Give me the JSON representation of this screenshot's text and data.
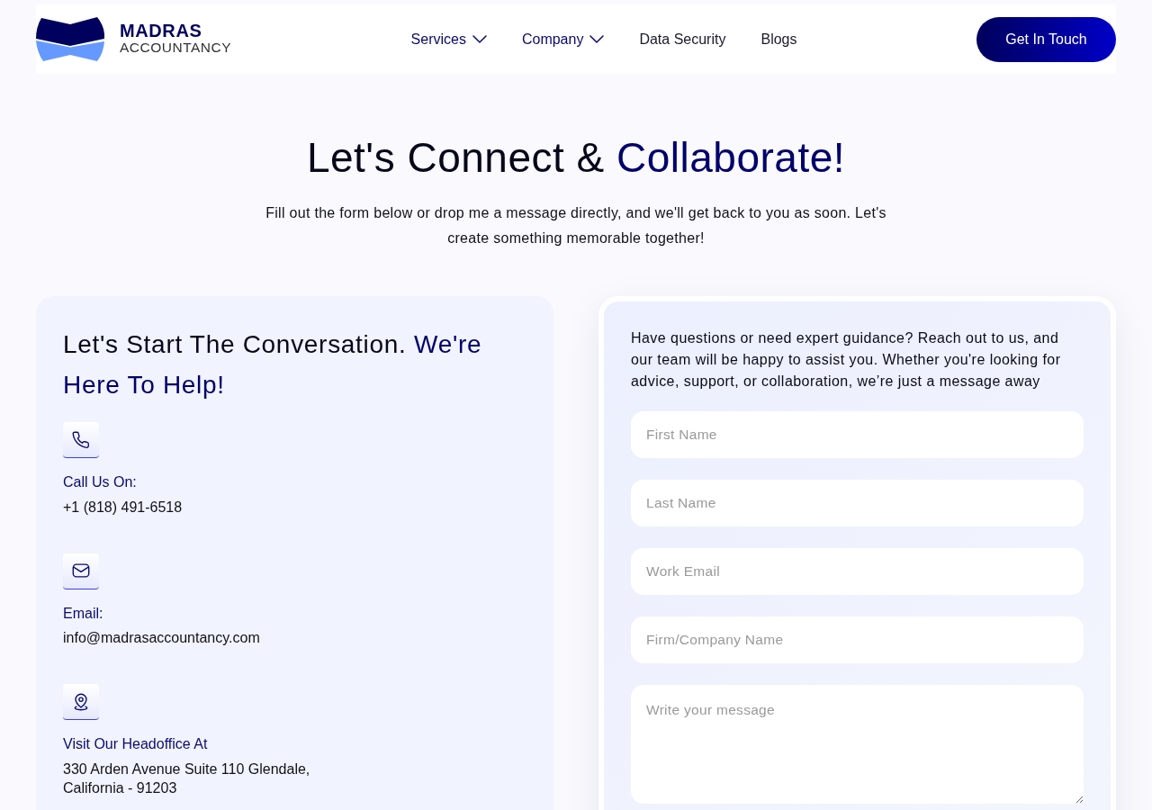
{
  "header": {
    "logo": {
      "name": "MADRAS",
      "tagline": "ACCOUNTANCY"
    },
    "nav": [
      {
        "label": "Services",
        "kind": "dropdown"
      },
      {
        "label": "Company",
        "kind": "dropdown"
      },
      {
        "label": "Data Security",
        "kind": "link"
      },
      {
        "label": "Blogs",
        "kind": "link"
      }
    ],
    "cta_button": "Get In Touch"
  },
  "hero": {
    "title": {
      "text": "Let's Connect &",
      "highlight": "Collaborate!"
    },
    "subtitle": "Fill out the form below or drop me a message directly, and we'll get back to you as soon. Let's create something memorable together!"
  },
  "contact_card": {
    "heading": {
      "text": "Let's Start The Conversation.",
      "highlight": "We're Here To Help!"
    },
    "items": [
      {
        "kind": "phone",
        "label": "Call Us On:",
        "value": "+1 (818) 491-6518"
      },
      {
        "kind": "email",
        "label": "Email:",
        "value": "info@madrasaccountancy.com"
      },
      {
        "kind": "location",
        "label": "Visit Our Headoffice At",
        "value": "330 Arden Avenue Suite 110 Glendale, California - 91203"
      }
    ]
  },
  "form_card": {
    "intro": "Have questions or need expert guidance? Reach out to us, and our team will be happy to assist you. Whether you're looking for advice, support, or collaboration, we’re just a message away",
    "fields": [
      {
        "kind": "input",
        "placeholder": "First Name"
      },
      {
        "kind": "input",
        "placeholder": "Last Name"
      },
      {
        "kind": "input",
        "placeholder": "Work Email"
      },
      {
        "kind": "input",
        "placeholder": "Firm/Company Name"
      },
      {
        "kind": "textarea",
        "placeholder": "Write your message"
      }
    ]
  }
}
